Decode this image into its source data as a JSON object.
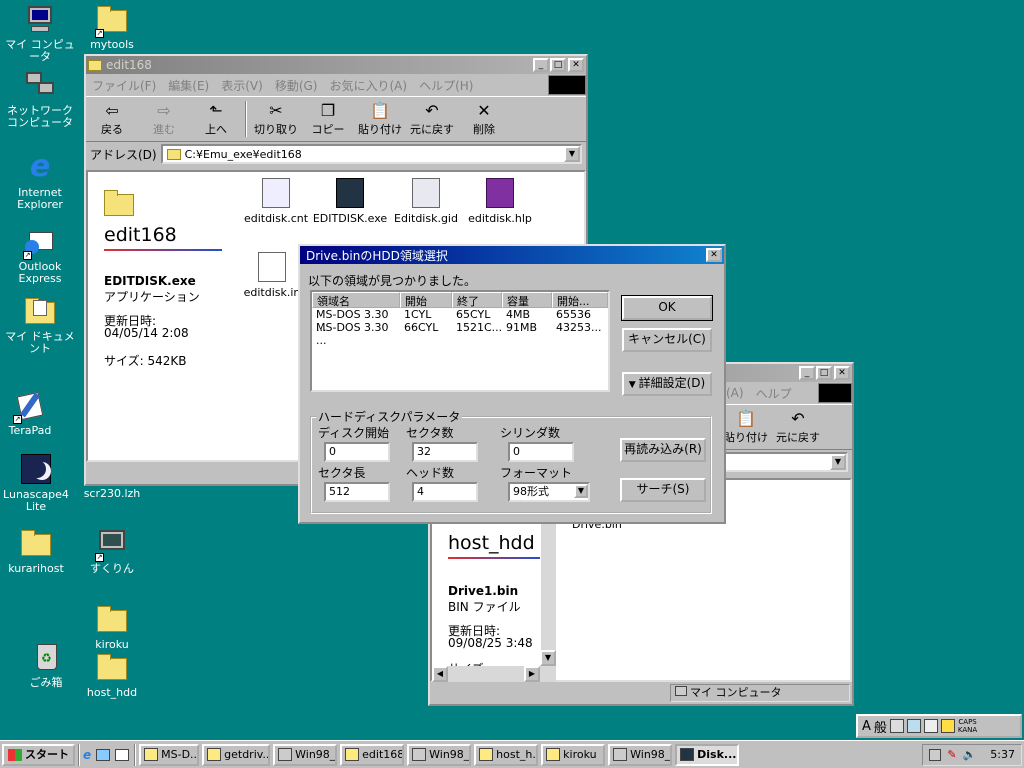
{
  "desktop_icons": [
    {
      "label": "マイ コンピュータ",
      "icon": "computer-icon"
    },
    {
      "label": "mytools",
      "icon": "folder-icon"
    },
    {
      "label": "ネットワーク コンピュータ",
      "icon": "network-icon"
    },
    {
      "label": "Internet Explorer",
      "icon": "ie-icon"
    },
    {
      "label": "Outlook Express",
      "icon": "outlook-icon"
    },
    {
      "label": "マイ ドキュメント",
      "icon": "documents-icon"
    },
    {
      "label": "TeraPad",
      "icon": "terapad-icon"
    },
    {
      "label": "Lunascape4 Lite",
      "icon": "lunascape-icon"
    },
    {
      "label": "scr230.lzh",
      "icon": "archive-icon"
    },
    {
      "label": "kurarihost",
      "icon": "folder-icon"
    },
    {
      "label": "すくりん",
      "icon": "screen-icon"
    },
    {
      "label": "kiroku",
      "icon": "folder-icon"
    },
    {
      "label": "ごみ箱",
      "icon": "recycle-icon"
    },
    {
      "label": "host_hdd",
      "icon": "folder-icon"
    }
  ],
  "explorer1": {
    "title": "edit168",
    "menu": [
      "ファイル(F)",
      "編集(E)",
      "表示(V)",
      "移動(G)",
      "お気に入り(A)",
      "ヘルプ(H)"
    ],
    "toolbar": [
      {
        "label": "戻る",
        "glyph": "⇦"
      },
      {
        "label": "進む",
        "glyph": "⇨"
      },
      {
        "label": "上へ",
        "glyph": "⬑"
      },
      {
        "label": "切り取り",
        "glyph": "✂"
      },
      {
        "label": "コピー",
        "glyph": "❐"
      },
      {
        "label": "貼り付け",
        "glyph": "📋"
      },
      {
        "label": "元に戻す",
        "glyph": "↶"
      },
      {
        "label": "削除",
        "glyph": "✕"
      }
    ],
    "address_label": "アドレス(D)",
    "address": "C:¥Emu_exe¥edit168",
    "folder_name": "edit168",
    "sel_name": "EDITDISK.exe",
    "sel_type": "アプリケーション",
    "modified_label": "更新日時:",
    "modified": "04/05/14 2:08",
    "size": "サイズ: 542KB",
    "files": [
      "editdisk.cnt",
      "EDITDISK.exe",
      "Editdisk.gid",
      "editdisk.hlp",
      "editdisk.in"
    ]
  },
  "explorer2": {
    "menu_partial": [
      "(A)",
      "ヘルプ"
    ],
    "toolbar_partial": [
      "貼り付け",
      "元に戻す"
    ],
    "folder_name": "host_hdd",
    "sel_name": "Drive1.bin",
    "sel_type": "BIN ファイル",
    "modified_label": "更新日時:",
    "modified": "09/08/25 3:48",
    "size_partial": "サイズ:",
    "file_partial": "Drive.bin",
    "status": "マイ コンピュータ"
  },
  "dialog": {
    "title": "Drive.binのHDD領域選択",
    "message": "以下の領域が見つかりました。",
    "columns": [
      "領域名",
      "開始",
      "終了",
      "容量",
      "開始..."
    ],
    "rows": [
      [
        "MS-DOS 3.30 ...",
        "1CYL",
        "65CYL",
        "4MB",
        "65536"
      ],
      [
        "MS-DOS 3.30 ...",
        "66CYL",
        "1521C...",
        "91MB",
        "43253..."
      ]
    ],
    "ok": "OK",
    "cancel": "キャンセル(C)",
    "details": "詳細設定(D)",
    "group_label": "ハードディスクパラメータ",
    "disk_start_label": "ディスク開始",
    "disk_start": "0",
    "sectors_label": "セクタ数",
    "sectors": "32",
    "cylinders_label": "シリンダ数",
    "cylinders": "0",
    "sector_len_label": "セクタ長",
    "sector_len": "512",
    "heads_label": "ヘッド数",
    "heads": "4",
    "format_label": "フォーマット",
    "format": "98形式",
    "reload": "再読み込み(R)",
    "search": "サーチ(S)"
  },
  "taskbar": {
    "start": "スタート",
    "tasks": [
      "MS-D...",
      "getdriv...",
      "Win98_...",
      "edit168",
      "Win98_...",
      "host_h...",
      "kiroku",
      "Win98_...",
      "Disk..."
    ],
    "clock": "5:37",
    "ime": [
      "A",
      "般",
      "CAPS",
      "KANA"
    ]
  }
}
